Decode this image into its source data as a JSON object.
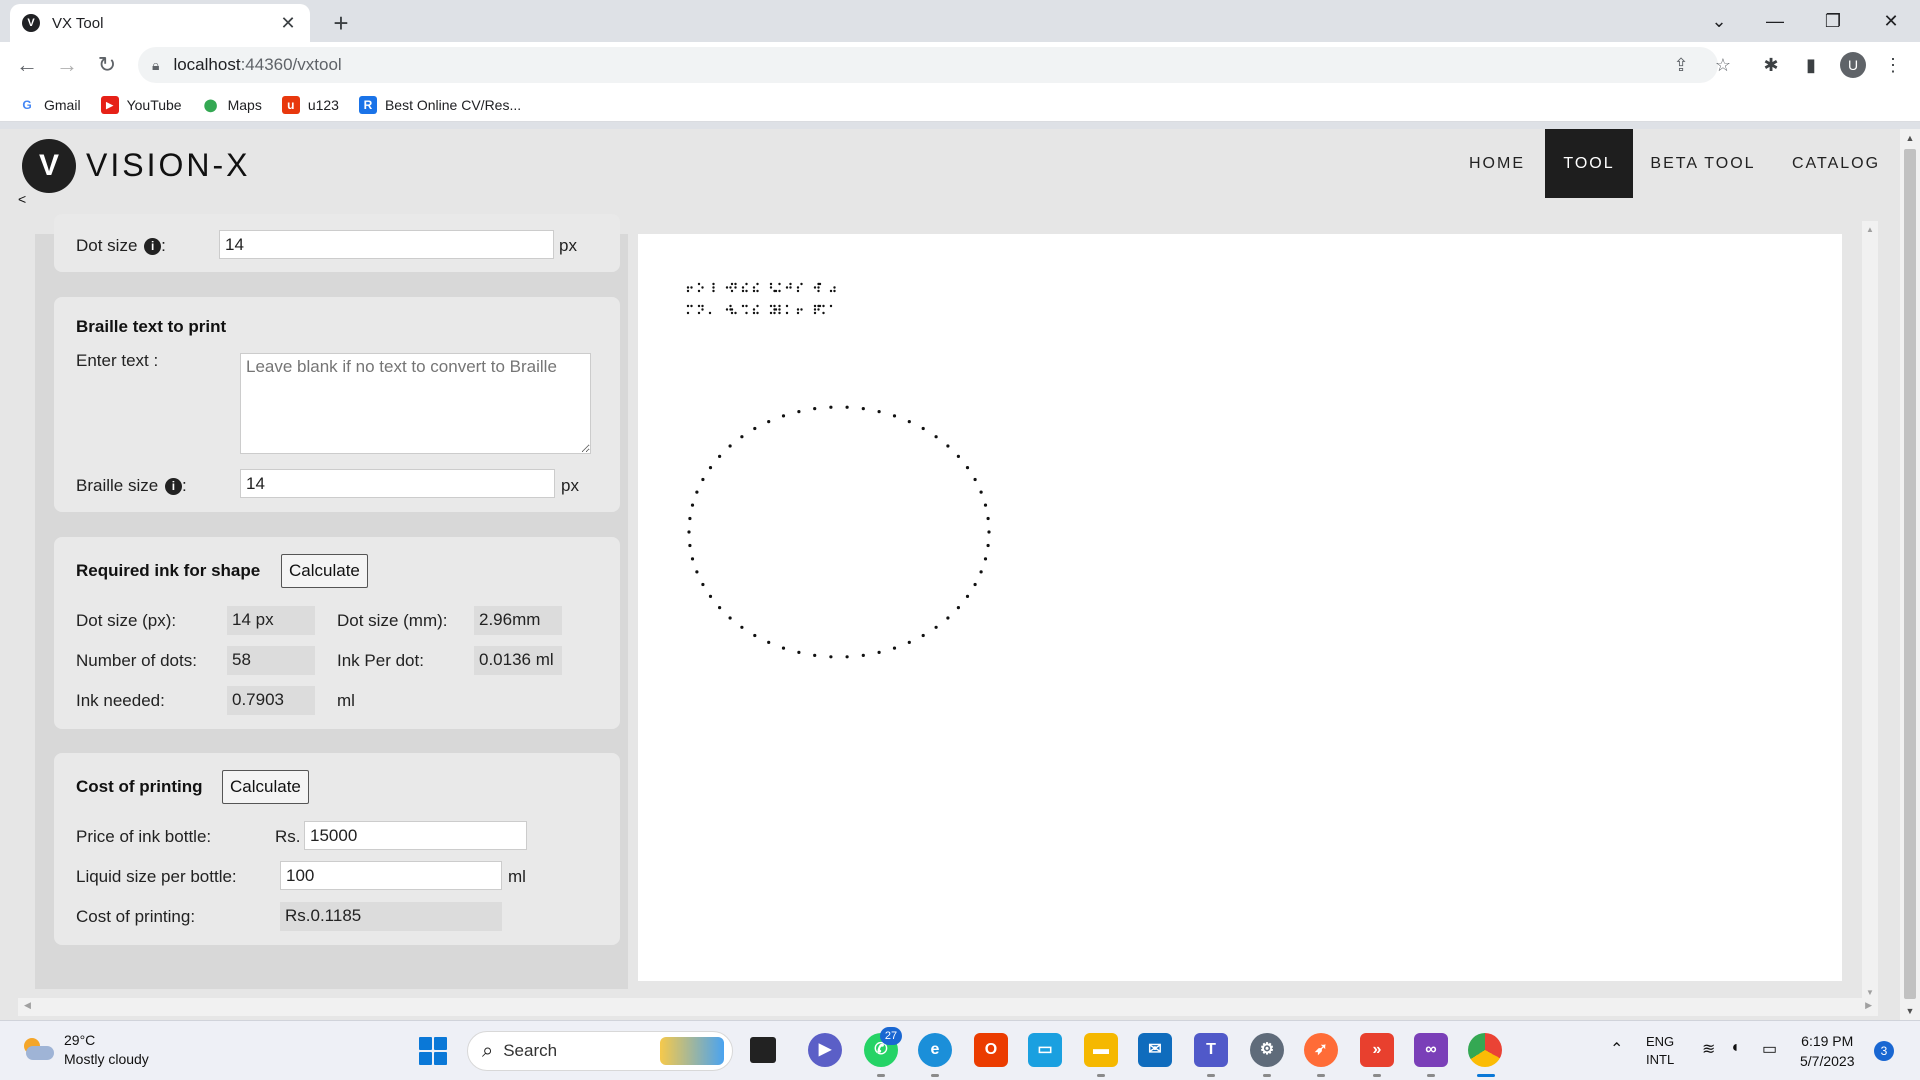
{
  "browser": {
    "tab_title": "VX Tool",
    "tab_favicon": "V",
    "url_host": "localhost",
    "url_rest": ":44360/vxtool",
    "bookmarks": [
      {
        "label": "Gmail",
        "icon": "G",
        "color": "#ffffff"
      },
      {
        "label": "YouTube",
        "icon": "▶",
        "color": "#e62117"
      },
      {
        "label": "Maps",
        "icon": "⬤",
        "color": "#34a853"
      },
      {
        "label": "u123",
        "icon": "u",
        "color": "#e8380d"
      },
      {
        "label": "Best Online CV/Res...",
        "icon": "R",
        "color": "#1a73e8"
      }
    ],
    "profile_initial": "U"
  },
  "site": {
    "brand": "VISION-X",
    "logo_glyph": "V",
    "collapse": "<",
    "nav": [
      {
        "label": "HOME",
        "active": false
      },
      {
        "label": "TOOL",
        "active": true
      },
      {
        "label": "BETA TOOL",
        "active": false
      },
      {
        "label": "CATALOG",
        "active": false
      }
    ]
  },
  "dot_settings": {
    "label": "Dot size",
    "info": "i",
    "colon": ":",
    "value": "14",
    "unit": "px"
  },
  "braille": {
    "heading": "Braille text to print",
    "enter_label": "Enter text :",
    "placeholder": "Leave blank if no text to convert to Braille",
    "size_label": "Braille size",
    "info": "i",
    "colon": ":",
    "size_value": "14",
    "unit": "px"
  },
  "ink": {
    "heading": "Required ink for shape",
    "calc_label": "Calculate",
    "dot_px_label": "Dot size (px):",
    "dot_px_value": "14 px",
    "dot_mm_label": "Dot size (mm):",
    "dot_mm_value": "2.96mm",
    "num_dots_label": "Number of dots:",
    "num_dots_value": "58",
    "ink_per_dot_label": "Ink Per dot:",
    "ink_per_dot_value": "0.0136 ml",
    "ink_needed_label": "Ink needed:",
    "ink_needed_value": "0.7903",
    "ink_needed_unit": "ml"
  },
  "cost": {
    "heading": "Cost of printing",
    "calc_label": "Calculate",
    "price_label": "Price of ink bottle:",
    "price_prefix": "Rs.",
    "price_value": "15000",
    "liquid_label": "Liquid size per bottle:",
    "liquid_value": "100",
    "liquid_unit": "ml",
    "cost_label": "Cost of printing:",
    "cost_value": "Rs.0.1185"
  },
  "taskbar": {
    "temperature": "29°C",
    "weather": "Mostly cloudy",
    "search": "Search",
    "badge": "27",
    "lang_top": "ENG",
    "lang_bottom": "INTL",
    "time": "6:19 PM",
    "date": "5/7/2023",
    "notifications": "3"
  }
}
